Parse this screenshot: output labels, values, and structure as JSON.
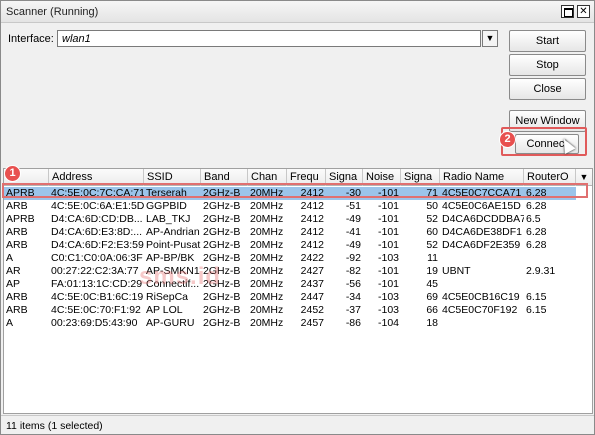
{
  "window": {
    "title": "Scanner (Running)"
  },
  "interface": {
    "label": "Interface:",
    "value": "wlan1"
  },
  "buttons": {
    "start": "Start",
    "stop": "Stop",
    "close": "Close",
    "new_window": "New Window",
    "connect": "Connect"
  },
  "annotations": {
    "marker1": "1",
    "marker2": "2"
  },
  "table": {
    "columns": [
      "",
      "Address",
      "SSID",
      "Band",
      "Chan",
      "Frequ",
      "Signa",
      "Noise",
      "Signa",
      "Radio Name",
      "RouterO"
    ],
    "rows": [
      [
        "APRB",
        "4C:5E:0C:7C:CA:71",
        "Terserah",
        "2GHz-B",
        "20MHz",
        "2412",
        "-30",
        "-101",
        "71",
        "4C5E0C7CCA71",
        "6.28"
      ],
      [
        "ARB",
        "4C:5E:0C:6A:E1:5D",
        "GGPBID",
        "2GHz-B",
        "20MHz",
        "2412",
        "-51",
        "-101",
        "50",
        "4C5E0C6AE15D",
        "6.28"
      ],
      [
        "APRB",
        "D4:CA:6D:CD:DB...",
        "LAB_TKJ",
        "2GHz-B",
        "20MHz",
        "2412",
        "-49",
        "-101",
        "52",
        "D4CA6DCDDBA7",
        "6.5"
      ],
      [
        "ARB",
        "D4:CA:6D:E3:8D:...",
        "AP-Andrian",
        "2GHz-B",
        "20MHz",
        "2412",
        "-41",
        "-101",
        "60",
        "D4CA6DE38DF1",
        "6.28"
      ],
      [
        "ARB",
        "D4:CA:6D:F2:E3:59",
        "Point-Pusat",
        "2GHz-B",
        "20MHz",
        "2412",
        "-49",
        "-101",
        "52",
        "D4CA6DF2E359",
        "6.28"
      ],
      [
        "A",
        "C0:C1:C0:0A:06:3F",
        "AP-BP/BK",
        "2GHz-B",
        "20MHz",
        "2422",
        "-92",
        "-103",
        "11",
        "",
        ""
      ],
      [
        "AR",
        "00:27:22:C2:3A:77",
        "AP-SMKN1",
        "2GHz-B",
        "20MHz",
        "2427",
        "-82",
        "-101",
        "19",
        "UBNT",
        "2.9.31"
      ],
      [
        "AP",
        "FA:01:13:1C:CD:29",
        "Connectif...",
        "2GHz-B",
        "20MHz",
        "2437",
        "-56",
        "-101",
        "45",
        "",
        ""
      ],
      [
        "ARB",
        "4C:5E:0C:B1:6C:19",
        "RiSepCa",
        "2GHz-B",
        "20MHz",
        "2447",
        "-34",
        "-103",
        "69",
        "4C5E0CB16C19",
        "6.15"
      ],
      [
        "ARB",
        "4C:5E:0C:70:F1:92",
        "AP LOL",
        "2GHz-B",
        "20MHz",
        "2452",
        "-37",
        "-103",
        "66",
        "4C5E0C70F192",
        "6.15"
      ],
      [
        "A",
        "00:23:69:D5:43:90",
        "AP-GURU",
        "2GHz-B",
        "20MHz",
        "2457",
        "-86",
        "-104",
        "18",
        "",
        ""
      ]
    ],
    "selected_row": 0
  },
  "watermark": "sms.id",
  "status": {
    "text": "11 items (1 selected)"
  },
  "colors": {
    "selection": "#9bc4ea",
    "highlight": "#e05a5a"
  }
}
